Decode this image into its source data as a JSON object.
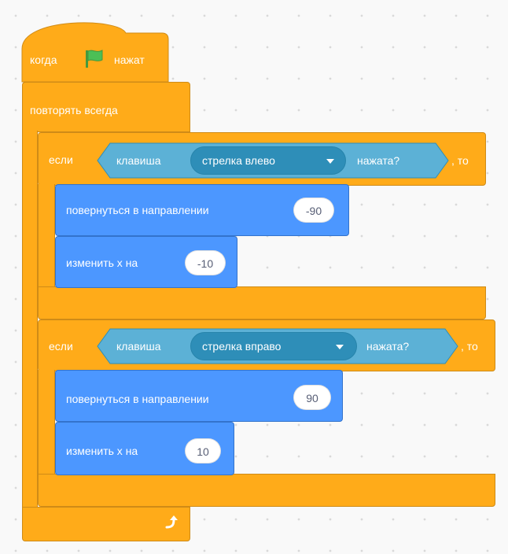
{
  "hat": {
    "label_when": "когда",
    "flag_icon": "green-flag-icon",
    "label_clicked": "нажат"
  },
  "forever": {
    "label": "повторять всегда",
    "loop_icon": "loop-arrow-icon"
  },
  "if_blocks": [
    {
      "label_if": "если",
      "sensor_label": "клавиша",
      "key": "стрелка влево",
      "sensor_suffix": "нажата?",
      "label_then": ", то",
      "turn": {
        "label": "повернуться в направлении",
        "value": "-90"
      },
      "change": {
        "label": "изменить x на",
        "value": "-10"
      }
    },
    {
      "label_if": "если",
      "sensor_label": "клавиша",
      "key": "стрелка вправо",
      "sensor_suffix": "нажата?",
      "label_then": ", то",
      "turn": {
        "label": "повернуться в направлении",
        "value": "90"
      },
      "change": {
        "label": "изменить x на",
        "value": "10"
      }
    }
  ],
  "colors": {
    "control": "#ffab19",
    "motion": "#4c97ff",
    "sensing": "#5cb1d6",
    "sensing_dark": "#2e8eb8",
    "flag": "#4cbf56"
  }
}
